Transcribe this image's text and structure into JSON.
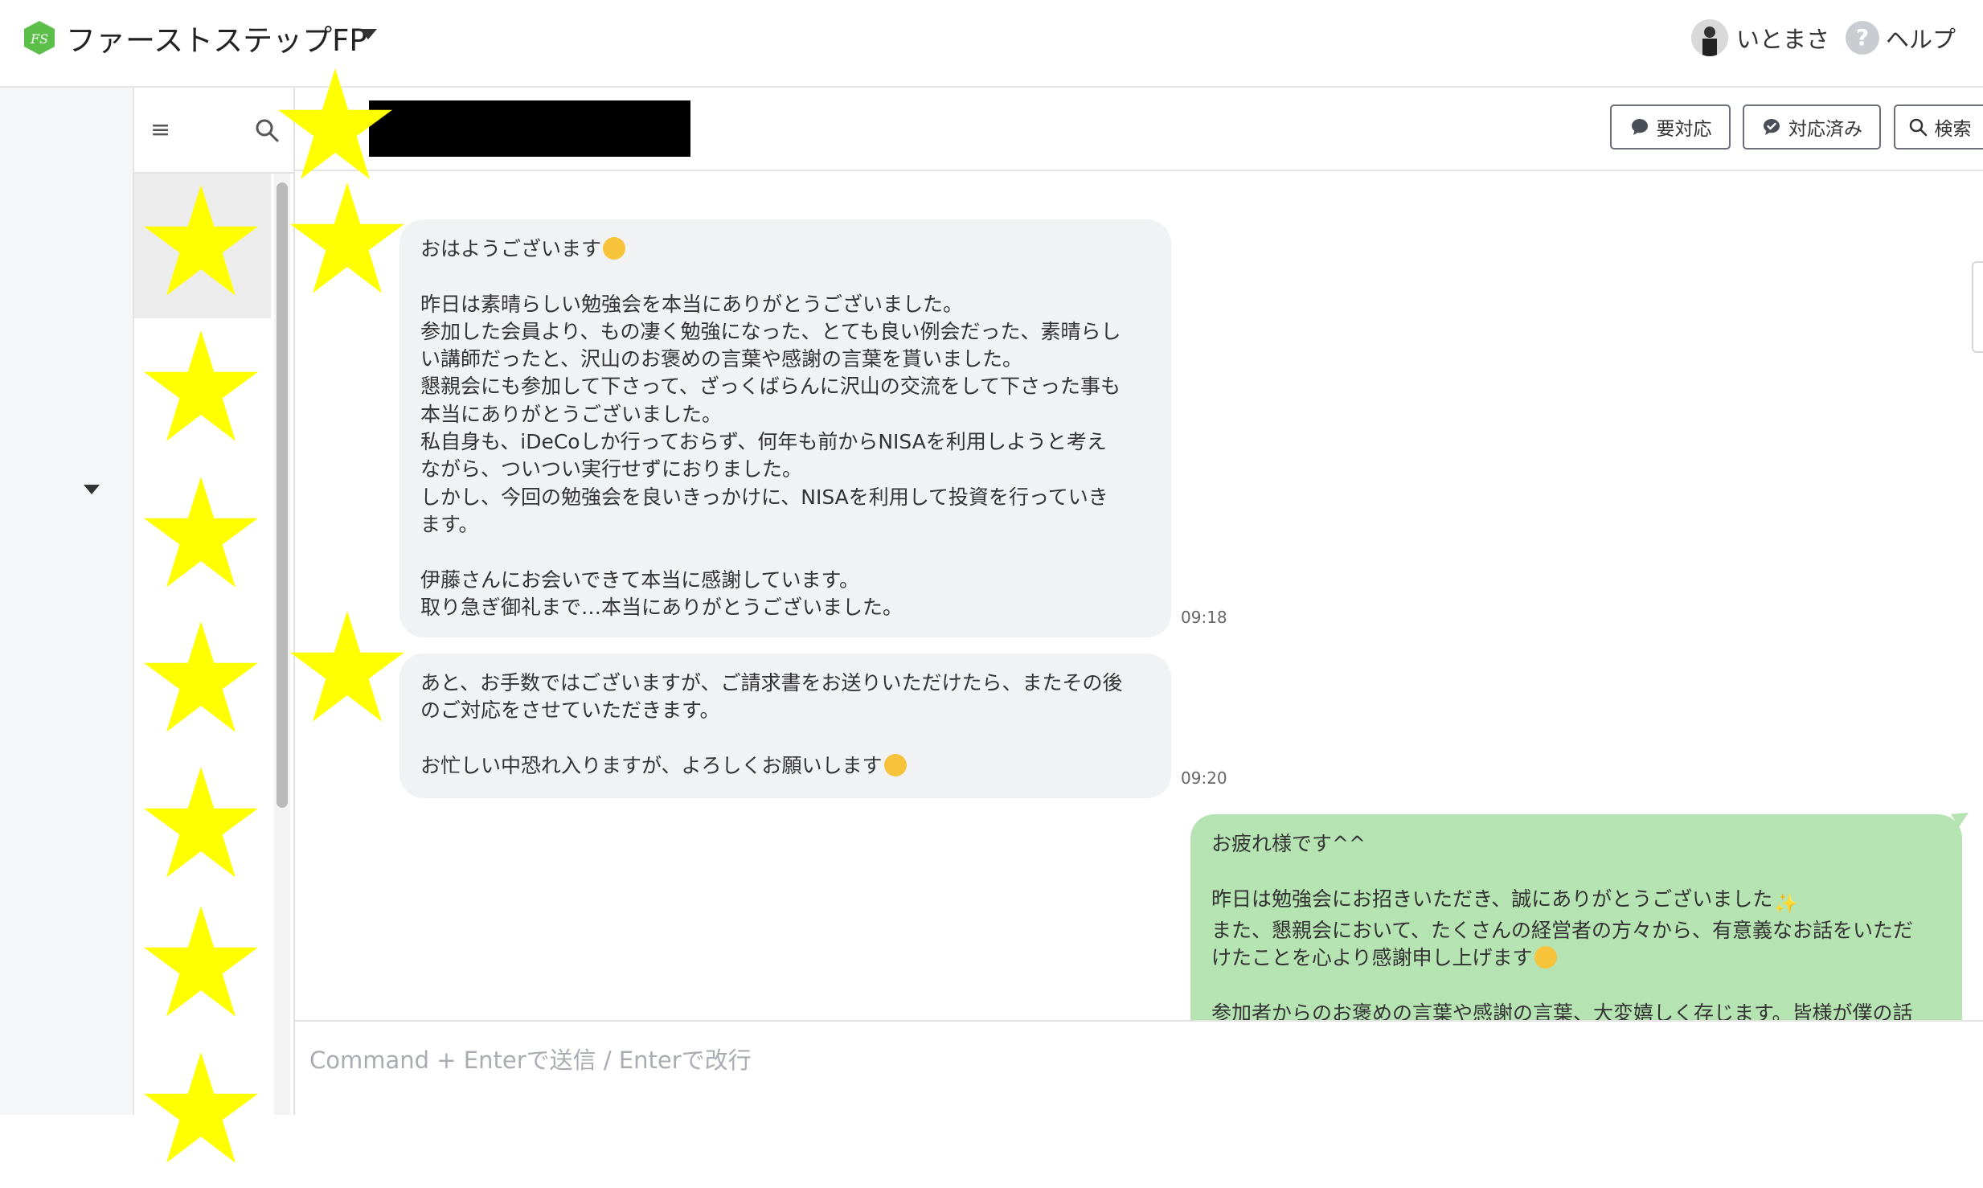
{
  "header": {
    "logo_text": "FS",
    "account_name": "ファーストステップFP",
    "user_name": "いとまさ",
    "help_label": "ヘルプ",
    "help_icon_glyph": "?"
  },
  "list": {
    "menu_icon": "menu-icon",
    "search_icon": "search-icon"
  },
  "chat_header": {
    "btn_needs_action": "要対応",
    "btn_done": "対応済み",
    "btn_search": "検索"
  },
  "messages": [
    {
      "side": "in",
      "text": "おはようございます",
      "text_rest": "\n\n昨日は素晴らしい勉強会を本当にありがとうございました。\n参加した会員より、もの凄く勉強になった、とても良い例会だった、素晴らし\nい講師だったと、沢山のお褒めの言葉や感謝の言葉を貰いました。\n懇親会にも参加して下さって、ざっくばらんに沢山の交流をして下さった事も\n本当にありがとうございました。\n私自身も、iDeCoしか行っておらず、何年も前からNISAを利用しようと考え\nながら、ついつい実行せずにおりました。\nしかし、今回の勉強会を良いきっかけに、NISAを利用して投資を行っていき\nます。\n\n伊藤さんにお会いできて本当に感謝しています。\n取り急ぎ御礼まで…本当にありがとうございました。",
      "time": "09:18"
    },
    {
      "side": "in",
      "text": "あと、お手数ではございますが、ご請求書をお送りいただけたら、またその後\nのご対応をさせていただきます。\n\nお忙しい中恐れ入りますが、よろしくお願いします",
      "time": "09:20"
    },
    {
      "side": "out",
      "line1": "お疲れ様です^^",
      "line2": "昨日は勉強会にお招きいただき、誠にありがとうございました",
      "line3": "また、懇親会において、たくさんの経営者の方々から、有意義なお話をいただ\nけたことを心より感謝申し上げます",
      "line4": "参加者からのお褒めの言葉や感謝の言葉、大変嬉しく存じます。皆様が僕の話"
    }
  ],
  "composer": {
    "placeholder": "Command + Enterで送信 / Enterで改行"
  },
  "colors": {
    "incoming_bubble": "#f1f2f4",
    "outgoing_bubble": "#b5e3b1",
    "logo_green": "#5cbf4a",
    "star_yellow": "#ffff00"
  }
}
